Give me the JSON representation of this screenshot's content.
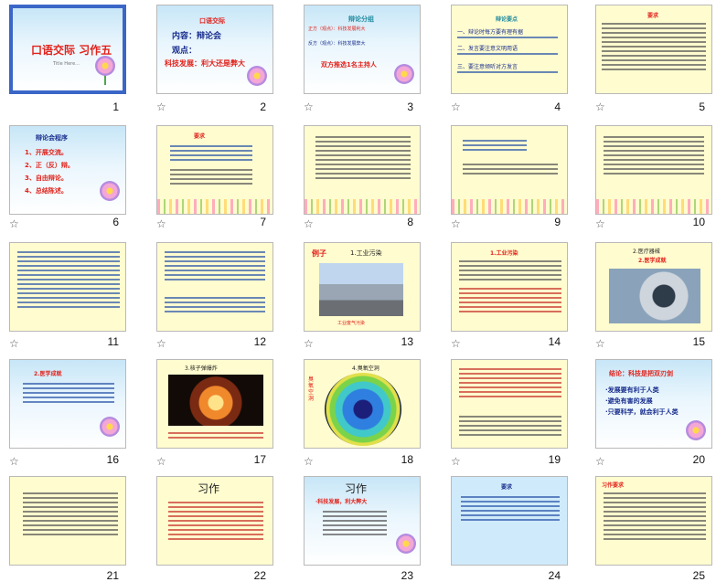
{
  "slides": [
    {
      "num": "1",
      "star": "",
      "title": "口语交际 习作五",
      "sub": "Title Here..."
    },
    {
      "num": "2",
      "star": "☆",
      "l1": "口语交际",
      "l2": "内容：辩论会",
      "l3": "观点：",
      "l4": "科技发展：利大还是弊大"
    },
    {
      "num": "3",
      "star": "☆",
      "l1": "辩论分组",
      "l2": "正方（观点）：科技发展利大",
      "l3": "反方（观点）：科技发展弊大",
      "l4": "双方推选1名主持人"
    },
    {
      "num": "4",
      "star": "☆",
      "l1": "辩论要点",
      "b1": "一、辩论时每方要有理有据",
      "b2": "二、发言要注意文明用语",
      "b3": "三、要注意倾听对方发言"
    },
    {
      "num": "5",
      "star": "☆",
      "l1": "要求"
    },
    {
      "num": "6",
      "star": "☆",
      "l1": "辩论会程序",
      "i1": "1、开展交流。",
      "i2": "2、正（反）辩。",
      "i3": "3、自由辩论。",
      "i4": "4、总结陈述。"
    },
    {
      "num": "7",
      "star": "☆",
      "l1": "要求"
    },
    {
      "num": "8",
      "star": "☆"
    },
    {
      "num": "9",
      "star": "☆"
    },
    {
      "num": "10",
      "star": "☆"
    },
    {
      "num": "11",
      "star": "☆"
    },
    {
      "num": "12",
      "star": "☆"
    },
    {
      "num": "13",
      "star": "☆",
      "l1": "例子",
      "l2": "1.工业污染",
      "cap": "工业废气污染"
    },
    {
      "num": "14",
      "star": "☆",
      "l1": "1.工业污染"
    },
    {
      "num": "15",
      "star": "☆",
      "l1": "2.医疗器械",
      "l2": "2.医学成就"
    },
    {
      "num": "16",
      "star": "☆",
      "l1": "2.医学成就"
    },
    {
      "num": "17",
      "star": "☆",
      "l1": "3.核子弹爆炸"
    },
    {
      "num": "18",
      "star": "☆",
      "l1": "4.臭氧空洞",
      "side": "臭氧空洞"
    },
    {
      "num": "19",
      "star": "☆"
    },
    {
      "num": "20",
      "star": "☆",
      "l1": "结论：科技是把双刃剑",
      "i1": "·发展要有利于人类",
      "i2": "·避免有害的发展",
      "i3": "·只要科学，就会利于人类"
    },
    {
      "num": "21",
      "star": ""
    },
    {
      "num": "22",
      "star": "",
      "l1": "习作"
    },
    {
      "num": "23",
      "star": "",
      "l1": "习作",
      "l2": "·科技发展，利大弊大"
    },
    {
      "num": "24",
      "star": "",
      "l1": "要求"
    },
    {
      "num": "25",
      "star": "",
      "l1": "习作要求"
    }
  ]
}
